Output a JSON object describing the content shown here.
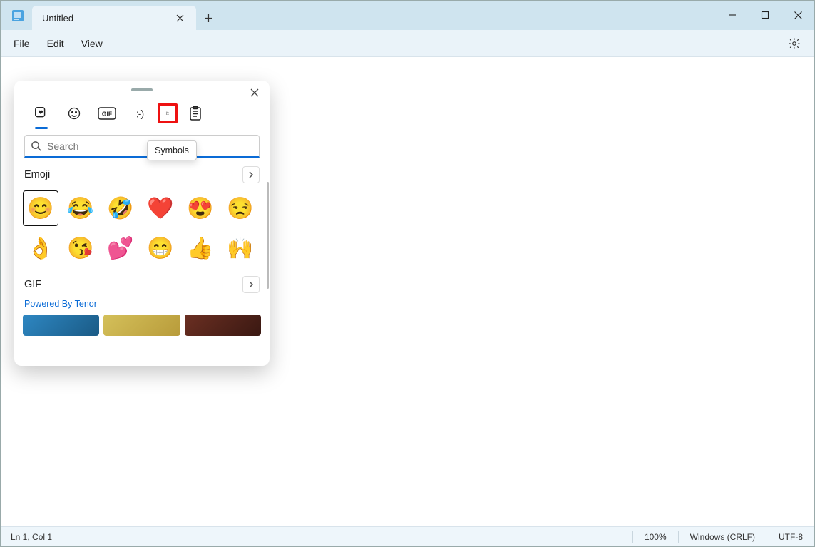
{
  "window": {
    "tab_title": "Untitled"
  },
  "menu": {
    "file": "File",
    "edit": "Edit",
    "view": "View"
  },
  "editor": {
    "content": ""
  },
  "statusbar": {
    "position": "Ln 1, Col 1",
    "zoom": "100%",
    "line_ending": "Windows (CRLF)",
    "encoding": "UTF-8"
  },
  "emoji_panel": {
    "tooltip": "Symbols",
    "search_placeholder": "Search",
    "sections": {
      "emoji": "Emoji",
      "gif": "GIF"
    },
    "tenor": "Powered By Tenor",
    "tabs": [
      {
        "name": "recent",
        "icon": "sticker-heart"
      },
      {
        "name": "emoji",
        "icon": "smiley"
      },
      {
        "name": "gif",
        "icon": "gif"
      },
      {
        "name": "kaomoji",
        "icon": "kaomoji",
        "label": ";-)"
      },
      {
        "name": "symbols",
        "icon": "symbols"
      },
      {
        "name": "clipboard",
        "icon": "clipboard"
      }
    ],
    "emoji_grid": [
      "😊",
      "😂",
      "🤣",
      "❤️",
      "😍",
      "😒",
      "👌",
      "😘",
      "💕",
      "😁",
      "👍",
      "🙌"
    ],
    "gif_colors": [
      "#2e87c2",
      "#b89b3a",
      "#6b2f22"
    ]
  }
}
